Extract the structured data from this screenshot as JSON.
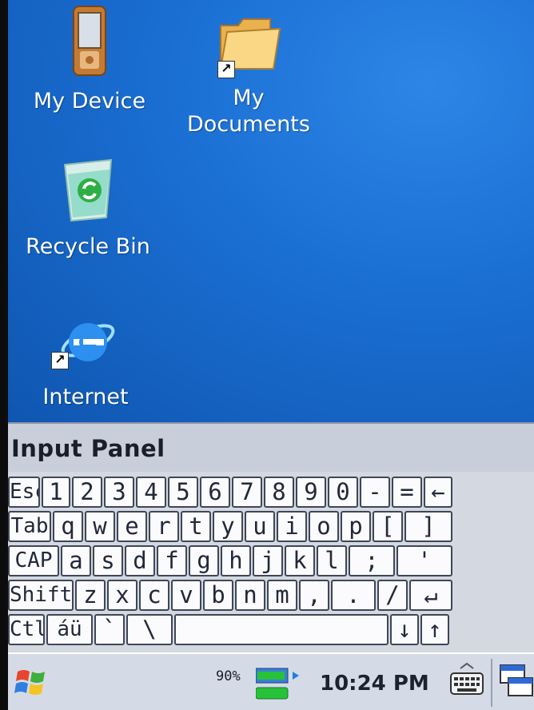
{
  "desktop": {
    "icons": [
      {
        "label": "My Device",
        "icon": "pda-device-icon"
      },
      {
        "label": "My\nDocuments",
        "icon": "folder-icon"
      },
      {
        "label": "Recycle Bin",
        "icon": "recycle-bin-icon"
      },
      {
        "label": "Internet",
        "icon": "internet-explorer-icon"
      }
    ]
  },
  "input_panel": {
    "title": "Input Panel",
    "rows": [
      [
        "Esc",
        "1",
        "2",
        "3",
        "4",
        "5",
        "6",
        "7",
        "8",
        "9",
        "0",
        "-",
        "=",
        "←"
      ],
      [
        "Tab",
        "q",
        "w",
        "e",
        "r",
        "t",
        "y",
        "u",
        "i",
        "o",
        "p",
        "[",
        "]"
      ],
      [
        "CAP",
        "a",
        "s",
        "d",
        "f",
        "g",
        "h",
        "j",
        "k",
        "l",
        ";",
        "'"
      ],
      [
        "Shift",
        "z",
        "x",
        "c",
        "v",
        "b",
        "n",
        "m",
        ",",
        ".",
        "/",
        "↵"
      ],
      [
        "Ctl",
        "áü",
        "`",
        "\\",
        "",
        "↓",
        "↑",
        "←",
        "→"
      ]
    ]
  },
  "taskbar": {
    "battery_percent": "90%",
    "time": "10:24 PM",
    "icons": [
      "windows-start-icon",
      "battery-icon",
      "keyboard-icon",
      "window-switch-icon"
    ],
    "colors": {
      "battery_green": "#27c23a",
      "accent_blue": "#1f7fe0"
    }
  }
}
